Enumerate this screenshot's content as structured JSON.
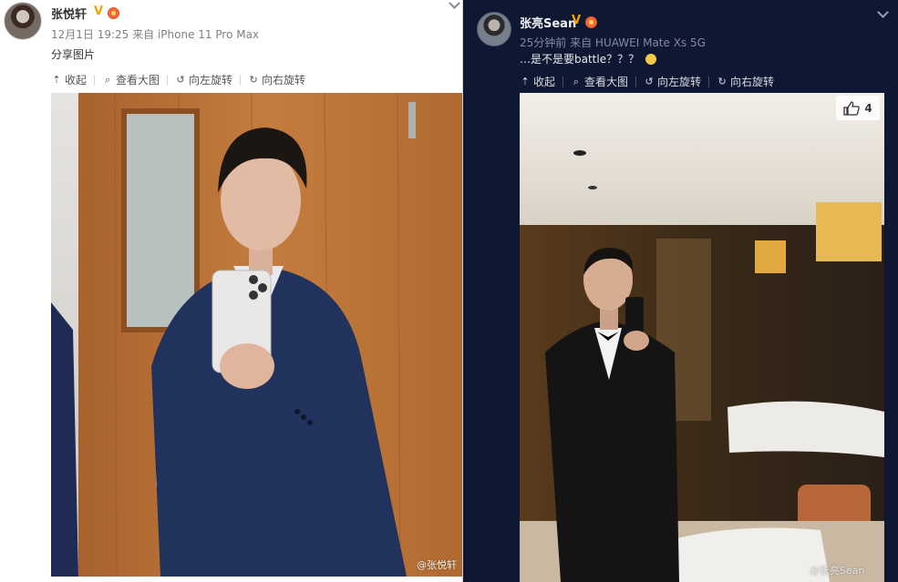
{
  "left_post": {
    "author": "张悦轩",
    "verified_mark": "V",
    "timestamp": "12月1日 19:25",
    "source": "来自 iPhone 11 Pro Max",
    "text": "分享图片",
    "toolbar": {
      "collect_label": "收起",
      "view_large_label": "查看大图",
      "rotate_left_label": "向左旋转",
      "rotate_right_label": "向右旋转"
    },
    "image_watermark": "@张悦轩"
  },
  "right_post": {
    "author": "张亮Sean",
    "verified_mark": "V",
    "timestamp": "25分钟前",
    "source": "来自 HUAWEI Mate Xs 5G",
    "text": "…是不是要battle？？？",
    "toolbar": {
      "collect_label": "收起",
      "view_large_label": "查看大图",
      "rotate_left_label": "向左旋转",
      "rotate_right_label": "向右旋转"
    },
    "like_count": "4",
    "image_watermark": "@张亮Sean"
  },
  "icons": [
    "collapse-icon",
    "magnifier-icon",
    "rotate-left-icon",
    "rotate-right-icon",
    "thumbs-up-icon",
    "chevron-down-icon",
    "level-badge-icon",
    "emoji-icon"
  ],
  "colors": {
    "left_background": "#ffffff",
    "right_background": "#0f1832",
    "verified_gold": "#f7a300",
    "meta_gray": "#808080"
  }
}
